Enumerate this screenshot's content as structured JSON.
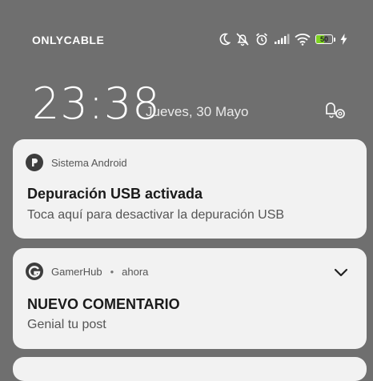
{
  "status_bar": {
    "carrier": "ONLYCABLE",
    "icons": [
      "moon-icon",
      "muted-bell-icon",
      "alarm-icon",
      "signal-icon",
      "wifi-icon",
      "battery-icon",
      "charging-bolt-icon"
    ],
    "battery_level": "50",
    "battery_fraction": 0.5,
    "battery_color": "#7ed321"
  },
  "lockscreen": {
    "time": "23:38",
    "date": "Jueves, 30 Mayo",
    "settings_icon": "notification-settings-icon"
  },
  "notifications": [
    {
      "app": "Sistema Android",
      "icon": "android-system-icon",
      "title": "Depuración USB activada",
      "text": "Toca aquí para desactivar la depuración USB"
    },
    {
      "app": "GamerHub",
      "separator": "•",
      "time": "ahora",
      "icon": "gamerhub-icon",
      "title": "NUEVO COMENTARIO",
      "text": "Genial tu post"
    }
  ]
}
